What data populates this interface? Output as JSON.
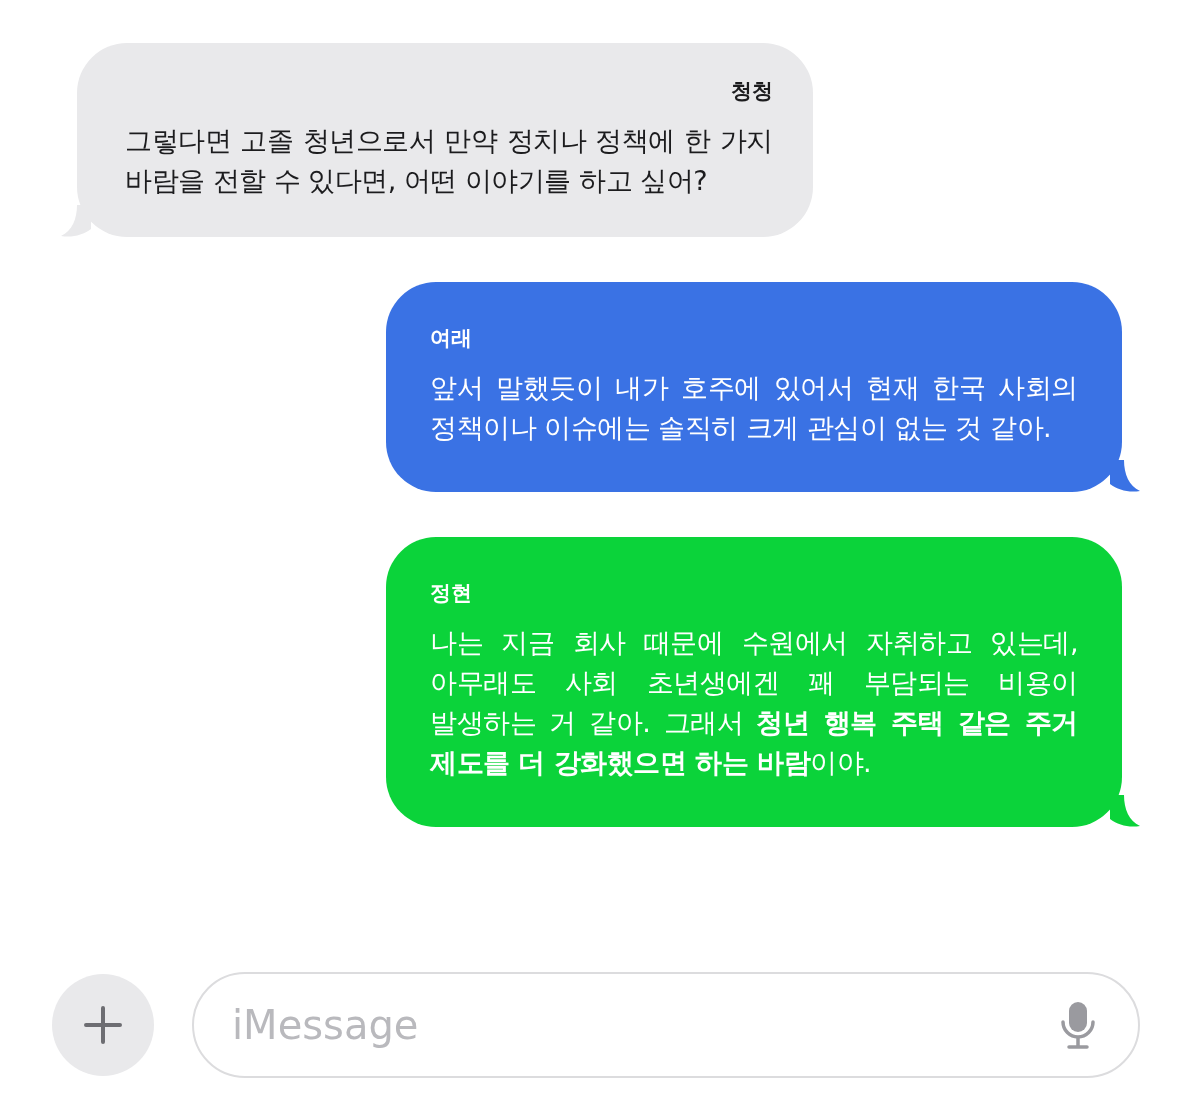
{
  "messages": [
    {
      "kind": "incoming",
      "sender": "청청",
      "color": "#e9e9eb",
      "text": "그렇다면 고졸 청년으로서 만약 정치나 정책에 한 가지 바람을 전할 수 있다면, 어떤 이야기를 하고 싶어?"
    },
    {
      "kind": "outgoing",
      "sender": "여래",
      "color": "#3a72e4",
      "text": "앞서 말했듯이 내가 호주에 있어서 현재 한국 사회의 정책이나 이슈에는 솔직히 크게 관심이 없는 것 같아."
    },
    {
      "kind": "outgoing",
      "sender": "정현",
      "color": "#0bd33a",
      "text": "나는 지금 회사 때문에 수원에서 자취하고 있는데, 아무래도 사회 초년생에겐 꽤 부담되는 비용이 발생하는 거 같아. 그래서 **청년 행복 주택 같은 주거 제도를 더 강화했으면 하는 바람**이야."
    }
  ],
  "input": {
    "placeholder": "iMessage"
  }
}
